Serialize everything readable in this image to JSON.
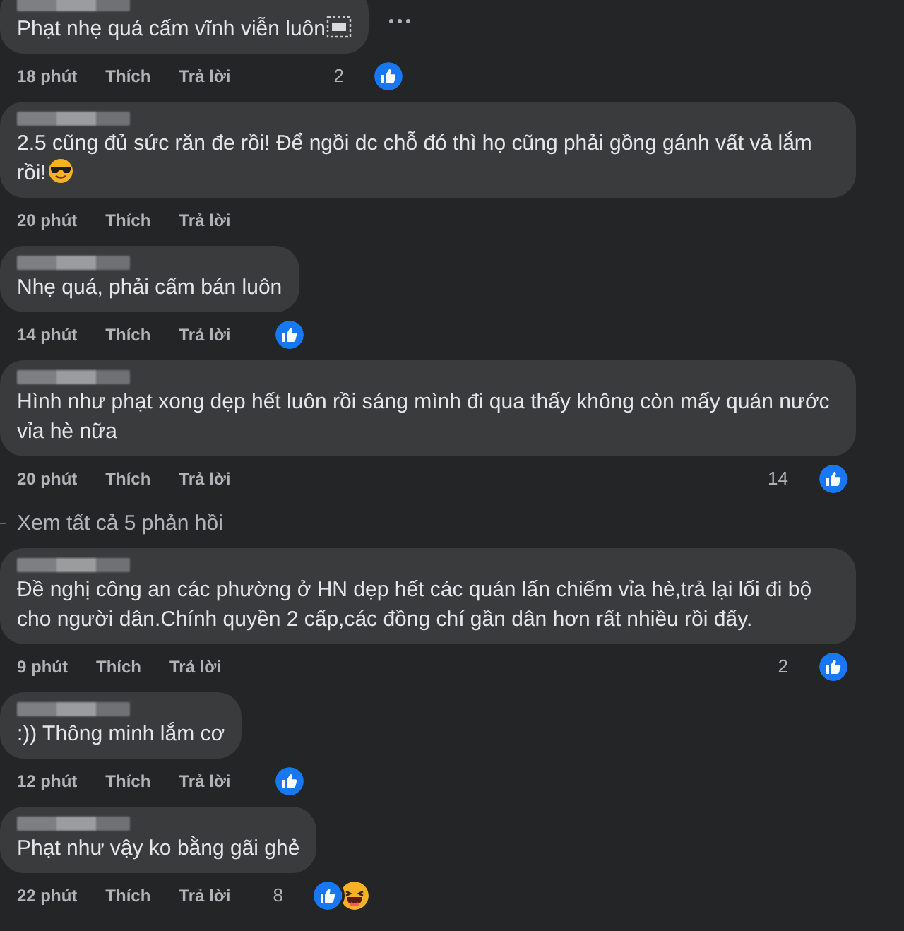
{
  "comments": [
    {
      "text": "Phạt nhẹ quá cấm vĩnh viễn luôn",
      "end_icon": {
        "kind": "dotted_square"
      },
      "more_menu": true,
      "time": "18 phút",
      "like": "Thích",
      "reply": "Trả lời",
      "count": "2",
      "reactions": [
        {
          "kind": "like"
        }
      ]
    },
    {
      "text": "2.5 cũng đủ sức răn đe rồi! Để ngồi dc chỗ đó thì họ cũng phải gồng gánh vất vả lắm rồi!",
      "end_icon": {
        "kind": "sunglasses"
      },
      "more_menu": false,
      "time": "20 phút",
      "like": "Thích",
      "reply": "Trả lời"
    },
    {
      "text": "Nhẹ quá, phải cấm bán luôn",
      "more_menu": false,
      "time": "14 phút",
      "like": "Thích",
      "reply": "Trả lời",
      "reactions": [
        {
          "kind": "like"
        }
      ]
    },
    {
      "text": "Hình như phạt xong dẹp hết luôn rồi sáng mình đi qua thấy không còn mấy quán nước vỉa hè nữa",
      "more_menu": false,
      "time": "20 phút",
      "like": "Thích",
      "reply": "Trả lời",
      "count": "14",
      "reactions": [
        {
          "kind": "like"
        }
      ],
      "replies_link": "Xem tất cả 5 phản hồi"
    },
    {
      "text": "Đề nghị công an các phường ở HN dẹp hết các quán lấn chiếm vỉa hè,trả lại lối đi bộ cho người dân.Chính quyền 2 cấp,các đồng chí gần dân hơn rất nhiều rồi đấy.",
      "more_menu": false,
      "time": "9 phút",
      "like": "Thích",
      "reply": "Trả lời",
      "count": "2",
      "reactions": [
        {
          "kind": "like"
        }
      ]
    },
    {
      "text": ":)) Thông minh lắm cơ",
      "more_menu": false,
      "time": "12 phút",
      "like": "Thích",
      "reply": "Trả lời",
      "reactions": [
        {
          "kind": "like"
        }
      ]
    },
    {
      "text": "Phạt như vậy ko bằng gãi ghẻ",
      "more_menu": false,
      "time": "22 phút",
      "like": "Thích",
      "reply": "Trả lời",
      "count": "8",
      "reactions": [
        {
          "kind": "like"
        },
        {
          "kind": "haha"
        }
      ]
    }
  ]
}
